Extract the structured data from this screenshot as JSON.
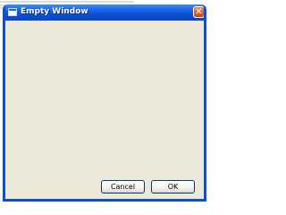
{
  "window": {
    "title": "Empty Window",
    "title_icon": "window-icon",
    "close_label": "✕"
  },
  "buttons": {
    "cancel_label": "Cancel",
    "ok_label": "OK"
  },
  "colors": {
    "titlebar": "#0b4fd6",
    "client_background": "#ece9d8",
    "close_button": "#c8461f"
  }
}
